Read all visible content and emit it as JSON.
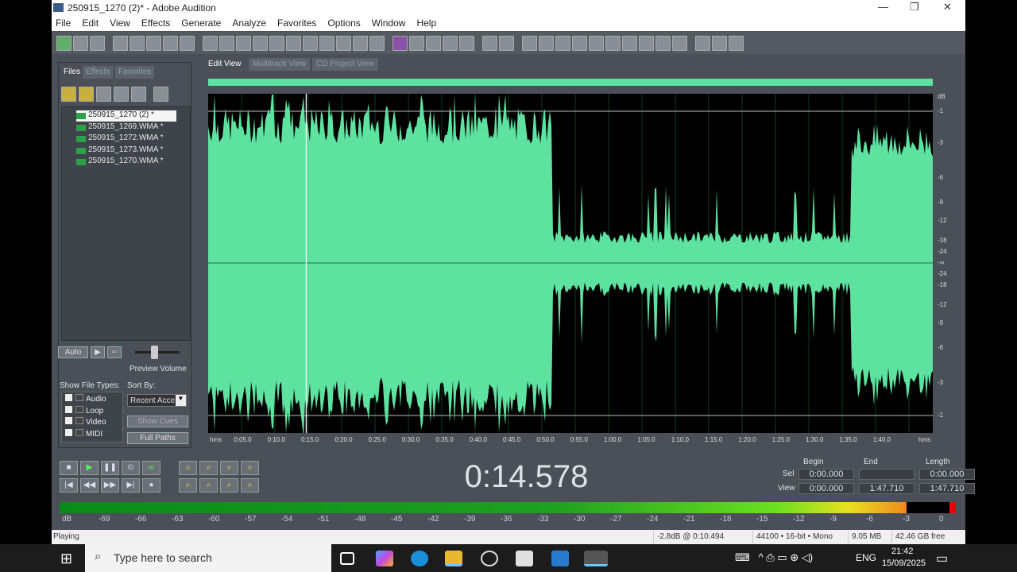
{
  "window": {
    "title": "250915_1270 (2)* - Adobe Audition",
    "min": "—",
    "max": "❐",
    "close": "✕"
  },
  "menu": [
    "File",
    "Edit",
    "View",
    "Effects",
    "Generate",
    "Analyze",
    "Favorites",
    "Options",
    "Window",
    "Help"
  ],
  "left_panel": {
    "tabs": [
      "Files",
      "Effects",
      "Favorites"
    ],
    "files": [
      "250915_1270 (2) *",
      "250915_1269.WMA *",
      "250915_1272.WMA *",
      "250915_1273.WMA *",
      "250915_1270.WMA *"
    ],
    "auto_label": "Auto",
    "play_glyph": "▶",
    "loop_glyph": "▫▫",
    "preview_volume_label": "Preview Volume",
    "show_file_types_label": "Show File Types:",
    "file_types": [
      "Audio",
      "Loop",
      "Video",
      "MIDI"
    ],
    "sort_by_label": "Sort By:",
    "sort_by_value": "Recent Acce",
    "show_cues": "Show Cues",
    "full_paths": "Full Paths"
  },
  "view_tabs": [
    "Edit View",
    "Multitrack View",
    "CD Project View"
  ],
  "db_scale": [
    "dB",
    "-1",
    "-3",
    "-6",
    "-9",
    "-12",
    "-18",
    "-24",
    "-∞",
    "-24",
    "-18",
    "-12",
    "-9",
    "-6",
    "-3",
    "-1"
  ],
  "ruler": [
    "hms",
    "0:05.0",
    "0:10.0",
    "0:15.0",
    "0:20.0",
    "0:25.0",
    "0:30.0",
    "0:35.0",
    "0:40.0",
    "0:45.0",
    "0:50.0",
    "0:55.0",
    "1:00.0",
    "1:05.0",
    "1:10.0",
    "1:15.0",
    "1:20.0",
    "1:25.0",
    "1:30.0",
    "1:35.0",
    "1:40.0",
    "hms"
  ],
  "playhead_seconds": 14.578,
  "total_seconds": 107.71,
  "time_display": "0:14.578",
  "selection": {
    "headers": [
      "Begin",
      "End",
      "Length"
    ],
    "rows": [
      {
        "label": "Sel",
        "begin": "0:00.000",
        "end": "",
        "length": "0:00.000"
      },
      {
        "label": "View",
        "begin": "0:00.000",
        "end": "1:47.710",
        "length": "1:47.710"
      }
    ]
  },
  "meter_scale": [
    "dB",
    "-69",
    "-66",
    "-63",
    "-60",
    "-57",
    "-54",
    "-51",
    "-48",
    "-45",
    "-42",
    "-39",
    "-36",
    "-33",
    "-30",
    "-27",
    "-24",
    "-21",
    "-18",
    "-15",
    "-12",
    "-9",
    "-6",
    "-3",
    "0"
  ],
  "status": {
    "state": "Playing",
    "level": "-2.8dB @  0:10.494",
    "format": "44100 • 16-bit • Mono",
    "size": "9.05 MB",
    "free": "42.46 GB free"
  },
  "taskbar": {
    "search_placeholder": "Type here to search",
    "lang": "ENG",
    "time": "21:42",
    "date": "15/09/2025"
  },
  "colors": {
    "wave": "#5de2a0",
    "bg": "#4b4f57"
  }
}
